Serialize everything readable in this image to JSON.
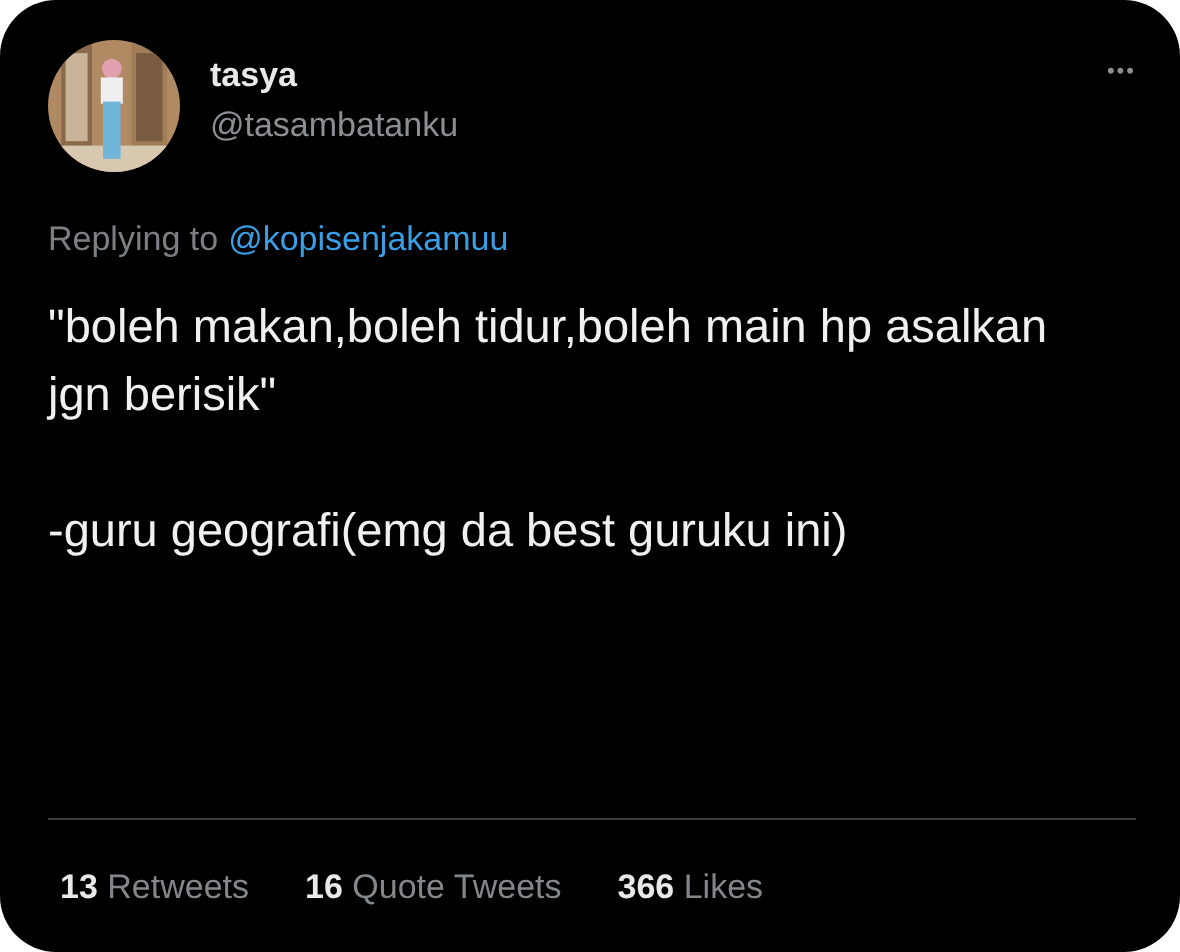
{
  "author": {
    "name": "tasya",
    "handle": "@tasambatanku"
  },
  "more_button": "•••",
  "reply_to": {
    "prefix": "Replying to",
    "mention": "@kopisenjakamuu"
  },
  "tweet_paragraphs": [
    "\"boleh makan,boleh tidur,boleh main hp asalkan jgn berisik\"",
    "-guru geografi(emg da best guruku ini)"
  ],
  "stats": [
    {
      "count": "13",
      "label": "Retweets"
    },
    {
      "count": "16",
      "label": "Quote Tweets"
    },
    {
      "count": "366",
      "label": "Likes"
    }
  ]
}
